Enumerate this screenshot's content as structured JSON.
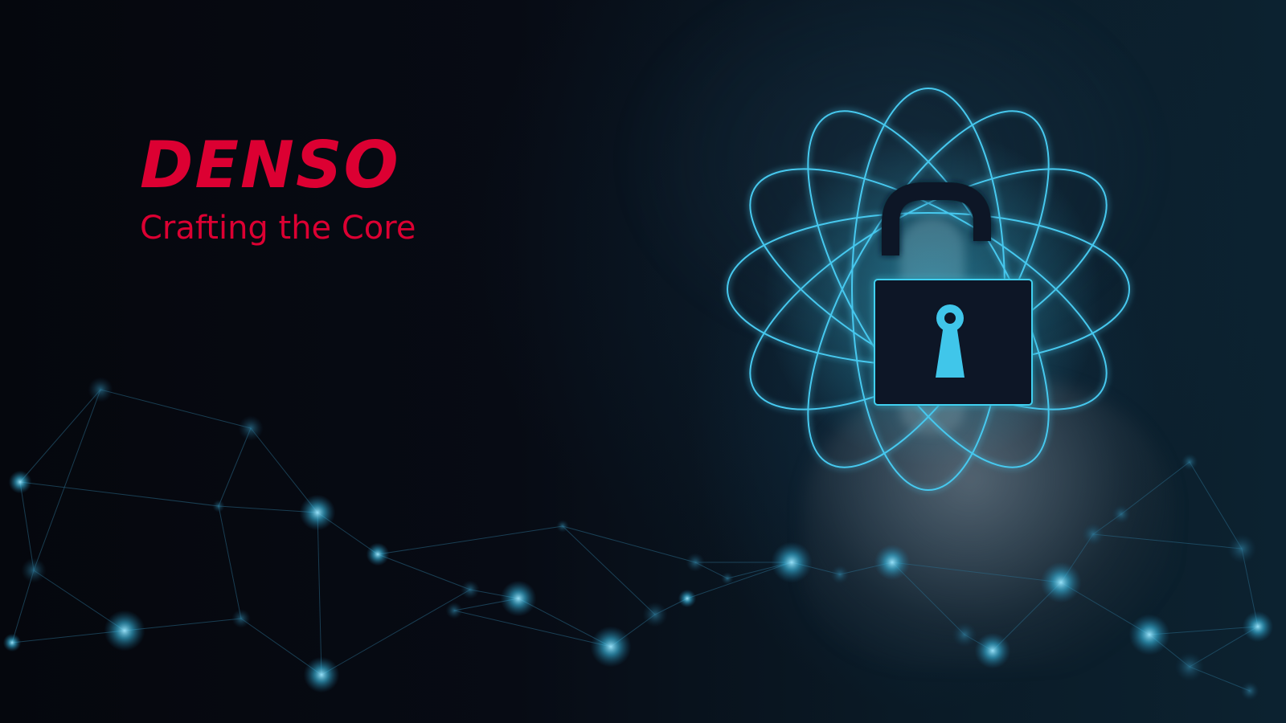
{
  "brand": {
    "name": "DENSO",
    "tagline": "Crafting the Core"
  },
  "colors": {
    "brand_red": "#dc0032",
    "glow_cyan": "#3fd0f0",
    "background": "#05070d",
    "lock_body": "#0b1826"
  },
  "icons": {
    "lock": "unlocked-padlock-icon",
    "orbit": "atom-orbit-rings",
    "network": "network-node-graph"
  }
}
